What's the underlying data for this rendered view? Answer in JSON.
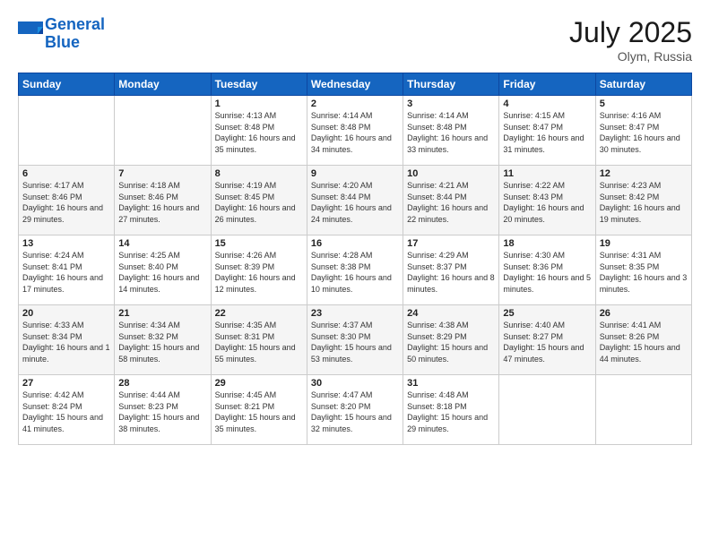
{
  "header": {
    "logo_line1": "General",
    "logo_line2": "Blue",
    "month_title": "July 2025",
    "location": "Olym, Russia"
  },
  "weekdays": [
    "Sunday",
    "Monday",
    "Tuesday",
    "Wednesday",
    "Thursday",
    "Friday",
    "Saturday"
  ],
  "weeks": [
    [
      {
        "day": "",
        "info": ""
      },
      {
        "day": "",
        "info": ""
      },
      {
        "day": "1",
        "info": "Sunrise: 4:13 AM\nSunset: 8:48 PM\nDaylight: 16 hours\nand 35 minutes."
      },
      {
        "day": "2",
        "info": "Sunrise: 4:14 AM\nSunset: 8:48 PM\nDaylight: 16 hours\nand 34 minutes."
      },
      {
        "day": "3",
        "info": "Sunrise: 4:14 AM\nSunset: 8:48 PM\nDaylight: 16 hours\nand 33 minutes."
      },
      {
        "day": "4",
        "info": "Sunrise: 4:15 AM\nSunset: 8:47 PM\nDaylight: 16 hours\nand 31 minutes."
      },
      {
        "day": "5",
        "info": "Sunrise: 4:16 AM\nSunset: 8:47 PM\nDaylight: 16 hours\nand 30 minutes."
      }
    ],
    [
      {
        "day": "6",
        "info": "Sunrise: 4:17 AM\nSunset: 8:46 PM\nDaylight: 16 hours\nand 29 minutes."
      },
      {
        "day": "7",
        "info": "Sunrise: 4:18 AM\nSunset: 8:46 PM\nDaylight: 16 hours\nand 27 minutes."
      },
      {
        "day": "8",
        "info": "Sunrise: 4:19 AM\nSunset: 8:45 PM\nDaylight: 16 hours\nand 26 minutes."
      },
      {
        "day": "9",
        "info": "Sunrise: 4:20 AM\nSunset: 8:44 PM\nDaylight: 16 hours\nand 24 minutes."
      },
      {
        "day": "10",
        "info": "Sunrise: 4:21 AM\nSunset: 8:44 PM\nDaylight: 16 hours\nand 22 minutes."
      },
      {
        "day": "11",
        "info": "Sunrise: 4:22 AM\nSunset: 8:43 PM\nDaylight: 16 hours\nand 20 minutes."
      },
      {
        "day": "12",
        "info": "Sunrise: 4:23 AM\nSunset: 8:42 PM\nDaylight: 16 hours\nand 19 minutes."
      }
    ],
    [
      {
        "day": "13",
        "info": "Sunrise: 4:24 AM\nSunset: 8:41 PM\nDaylight: 16 hours\nand 17 minutes."
      },
      {
        "day": "14",
        "info": "Sunrise: 4:25 AM\nSunset: 8:40 PM\nDaylight: 16 hours\nand 14 minutes."
      },
      {
        "day": "15",
        "info": "Sunrise: 4:26 AM\nSunset: 8:39 PM\nDaylight: 16 hours\nand 12 minutes."
      },
      {
        "day": "16",
        "info": "Sunrise: 4:28 AM\nSunset: 8:38 PM\nDaylight: 16 hours\nand 10 minutes."
      },
      {
        "day": "17",
        "info": "Sunrise: 4:29 AM\nSunset: 8:37 PM\nDaylight: 16 hours\nand 8 minutes."
      },
      {
        "day": "18",
        "info": "Sunrise: 4:30 AM\nSunset: 8:36 PM\nDaylight: 16 hours\nand 5 minutes."
      },
      {
        "day": "19",
        "info": "Sunrise: 4:31 AM\nSunset: 8:35 PM\nDaylight: 16 hours\nand 3 minutes."
      }
    ],
    [
      {
        "day": "20",
        "info": "Sunrise: 4:33 AM\nSunset: 8:34 PM\nDaylight: 16 hours\nand 1 minute."
      },
      {
        "day": "21",
        "info": "Sunrise: 4:34 AM\nSunset: 8:32 PM\nDaylight: 15 hours\nand 58 minutes."
      },
      {
        "day": "22",
        "info": "Sunrise: 4:35 AM\nSunset: 8:31 PM\nDaylight: 15 hours\nand 55 minutes."
      },
      {
        "day": "23",
        "info": "Sunrise: 4:37 AM\nSunset: 8:30 PM\nDaylight: 15 hours\nand 53 minutes."
      },
      {
        "day": "24",
        "info": "Sunrise: 4:38 AM\nSunset: 8:29 PM\nDaylight: 15 hours\nand 50 minutes."
      },
      {
        "day": "25",
        "info": "Sunrise: 4:40 AM\nSunset: 8:27 PM\nDaylight: 15 hours\nand 47 minutes."
      },
      {
        "day": "26",
        "info": "Sunrise: 4:41 AM\nSunset: 8:26 PM\nDaylight: 15 hours\nand 44 minutes."
      }
    ],
    [
      {
        "day": "27",
        "info": "Sunrise: 4:42 AM\nSunset: 8:24 PM\nDaylight: 15 hours\nand 41 minutes."
      },
      {
        "day": "28",
        "info": "Sunrise: 4:44 AM\nSunset: 8:23 PM\nDaylight: 15 hours\nand 38 minutes."
      },
      {
        "day": "29",
        "info": "Sunrise: 4:45 AM\nSunset: 8:21 PM\nDaylight: 15 hours\nand 35 minutes."
      },
      {
        "day": "30",
        "info": "Sunrise: 4:47 AM\nSunset: 8:20 PM\nDaylight: 15 hours\nand 32 minutes."
      },
      {
        "day": "31",
        "info": "Sunrise: 4:48 AM\nSunset: 8:18 PM\nDaylight: 15 hours\nand 29 minutes."
      },
      {
        "day": "",
        "info": ""
      },
      {
        "day": "",
        "info": ""
      }
    ]
  ]
}
